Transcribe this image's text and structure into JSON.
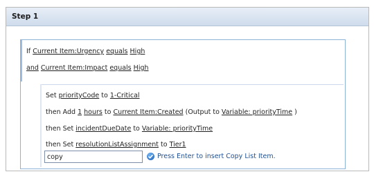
{
  "step": {
    "title": "Step 1"
  },
  "conditions": [
    {
      "prefix": "If",
      "field": "Current Item:Urgency",
      "operator": "equals",
      "value": "High"
    },
    {
      "prefix": "and",
      "field": "Current Item:Impact",
      "operator": "equals",
      "value": "High"
    }
  ],
  "actions": {
    "a1": {
      "set": "Set",
      "field": "priorityCode",
      "to": "to",
      "value": "1-Critical"
    },
    "a2": {
      "then": "then Add",
      "amount": "1",
      "unit": "hours",
      "to": "to",
      "target": "Current Item:Created",
      "output_pre": "(Output to",
      "output": "Variable: priorityTime",
      "output_post": ")"
    },
    "a3": {
      "then": "then Set",
      "field": "incidentDueDate",
      "to": "to",
      "value": "Variable: priorityTime"
    },
    "a4": {
      "then": "then Set",
      "field": "resolutionListAssignment",
      "to": "to",
      "value": "Tier1"
    }
  },
  "command_input": {
    "value": "copy"
  },
  "hint": {
    "text": "Press Enter to insert Copy List Item."
  },
  "colors": {
    "header_bg": "#d9e4f1",
    "rule_border": "#8db2d8",
    "hint": "#1f4f8f"
  }
}
